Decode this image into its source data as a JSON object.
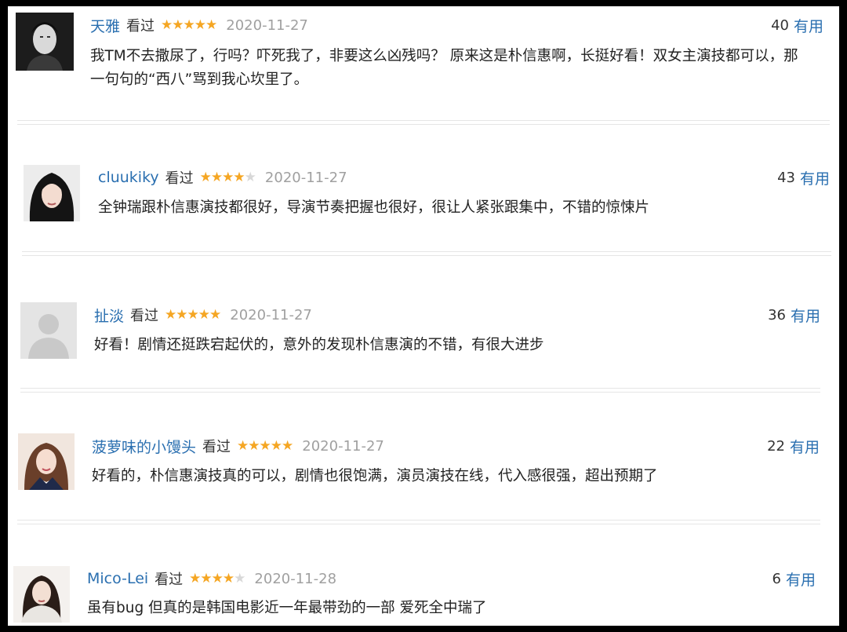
{
  "reviews": [
    {
      "username": "天雅",
      "watched": "看过",
      "rating": 5,
      "date": "2020-11-27",
      "votes": "40",
      "useful": "有用",
      "comment": "我TM不去撒尿了，行吗？吓死我了，非要这么凶残吗？ 原来这是朴信惠啊，长挺好看！双女主演技都可以，那一句句的“西八”骂到我心坎里了。",
      "avatar": "man-portrait"
    },
    {
      "username": "cluukiky",
      "watched": "看过",
      "rating": 4,
      "date": "2020-11-27",
      "votes": "43",
      "useful": "有用",
      "comment": "全钟瑞跟朴信惠演技都很好，导演节奏把握也很好，很让人紧张跟集中，不错的惊悚片",
      "avatar": "woman-portrait"
    },
    {
      "username": "扯淡",
      "watched": "看过",
      "rating": 5,
      "date": "2020-11-27",
      "votes": "36",
      "useful": "有用",
      "comment": "好看！剧情还挺跌宕起伏的，意外的发现朴信惠演的不错，有很大进步",
      "avatar": "default-avatar"
    },
    {
      "username": "菠萝味的小馒头",
      "watched": "看过",
      "rating": 5,
      "date": "2020-11-27",
      "votes": "22",
      "useful": "有用",
      "comment": "好看的，朴信惠演技真的可以，剧情也很饱满，演员演技在线，代入感很强，超出预期了",
      "avatar": "girl-portrait"
    },
    {
      "username": "Mico-Lei",
      "watched": "看过",
      "rating": 4,
      "date": "2020-11-28",
      "votes": "6",
      "useful": "有用",
      "comment": "虽有bug 但真的是韩国电影近一年最带劲的一部 爱死全中瑞了",
      "avatar": "woman-portrait-light"
    }
  ],
  "colors": {
    "username": "#2a6fb0",
    "star_on": "#f5a623",
    "star_off": "#d8d8d8",
    "date": "#a0a0a0"
  }
}
